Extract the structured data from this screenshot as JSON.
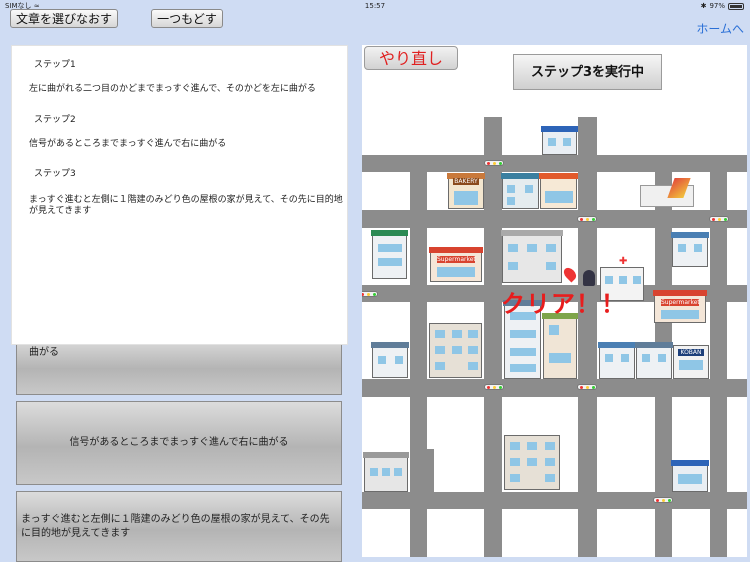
{
  "status_bar": {
    "carrier": "SIMなし",
    "time": "15:57",
    "battery": "97%"
  },
  "toolbar": {
    "reselect_label": "文章を選びなおす",
    "back_label": "一つもどす",
    "home_label": "ホームへ"
  },
  "steps": [
    {
      "title": "ステップ1",
      "text": "左に曲がれる二つ目のかどまでまっすぐ進んで、そのかどを左に曲がる"
    },
    {
      "title": "ステップ2",
      "text": "信号があるところまでまっすぐ進んで右に曲がる"
    },
    {
      "title": "ステップ3",
      "text": "まっすぐ進むと左側に１階建のみどり色の屋根の家が見えて、その先に目的地が見えてきます"
    }
  ],
  "list_buttons": [
    {
      "label": "曲がる"
    },
    {
      "label": "信号があるところまでまっすぐ進んで右に曲がる"
    },
    {
      "label": "まっすぐ進むと左側に１階建のみどり色の屋根の家が見えて、その先に目的地が見えてきます"
    }
  ],
  "map": {
    "retry_label": "やり直し",
    "exec_label": "ステップ3を実行中",
    "clear_label": "クリア！！",
    "supermarket_1": "Supermarket",
    "supermarket_2": "Supermarket",
    "koban_label": "KOBAN",
    "bakery_label": "BAKERY"
  },
  "colors": {
    "background": "#cfdcf3",
    "road": "#8c8c8c",
    "clear_red": "#e81d1d",
    "home_link_blue": "#2a6fd6"
  }
}
